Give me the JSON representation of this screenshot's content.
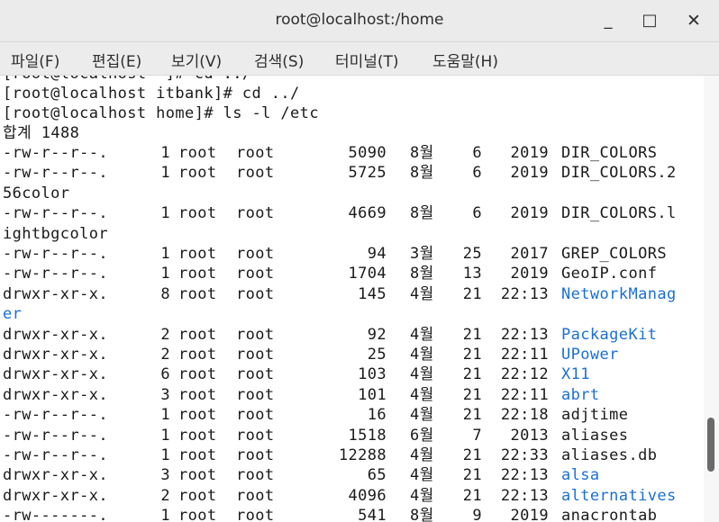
{
  "window": {
    "title": "root@localhost:/home",
    "minimize_label": "_",
    "maximize_label": "□",
    "close_label": "✕"
  },
  "menu": [
    "파일(F)",
    "편집(E)",
    "보기(V)",
    "검색(S)",
    "터미널(T)",
    "도움말(H)"
  ],
  "terminal": {
    "partial_top": "[root@localhost ~]# cd ../",
    "prompt_lines": [
      "[root@localhost itbank]# cd ../",
      "[root@localhost home]# ls -l /etc"
    ],
    "total": "합계 1488",
    "entries": [
      {
        "perm": "-rw-r--r--.",
        "links": "1",
        "owner": "root",
        "group": "root",
        "size": "5090",
        "month": "8월",
        "day": "6",
        "time": "2019",
        "name": "DIR_COLORS",
        "cont": "",
        "dir": false
      },
      {
        "perm": "-rw-r--r--.",
        "links": "1",
        "owner": "root",
        "group": "root",
        "size": "5725",
        "month": "8월",
        "day": "6",
        "time": "2019",
        "name": "DIR_COLORS.2",
        "cont": "56color",
        "dir": false
      },
      {
        "perm": "-rw-r--r--.",
        "links": "1",
        "owner": "root",
        "group": "root",
        "size": "4669",
        "month": "8월",
        "day": "6",
        "time": "2019",
        "name": "DIR_COLORS.l",
        "cont": "ightbgcolor",
        "dir": false
      },
      {
        "perm": "-rw-r--r--.",
        "links": "1",
        "owner": "root",
        "group": "root",
        "size": "94",
        "month": "3월",
        "day": "25",
        "time": "2017",
        "name": "GREP_COLORS",
        "cont": "",
        "dir": false
      },
      {
        "perm": "-rw-r--r--.",
        "links": "1",
        "owner": "root",
        "group": "root",
        "size": "1704",
        "month": "8월",
        "day": "13",
        "time": "2019",
        "name": "GeoIP.conf",
        "cont": "",
        "dir": false
      },
      {
        "perm": "drwxr-xr-x.",
        "links": "8",
        "owner": "root",
        "group": "root",
        "size": "145",
        "month": "4월",
        "day": "21",
        "time": "22:13",
        "name": "NetworkManag",
        "cont": "er",
        "dir": true
      },
      {
        "perm": "drwxr-xr-x.",
        "links": "2",
        "owner": "root",
        "group": "root",
        "size": "92",
        "month": "4월",
        "day": "21",
        "time": "22:13",
        "name": "PackageKit",
        "cont": "",
        "dir": true
      },
      {
        "perm": "drwxr-xr-x.",
        "links": "2",
        "owner": "root",
        "group": "root",
        "size": "25",
        "month": "4월",
        "day": "21",
        "time": "22:11",
        "name": "UPower",
        "cont": "",
        "dir": true
      },
      {
        "perm": "drwxr-xr-x.",
        "links": "6",
        "owner": "root",
        "group": "root",
        "size": "103",
        "month": "4월",
        "day": "21",
        "time": "22:12",
        "name": "X11",
        "cont": "",
        "dir": true
      },
      {
        "perm": "drwxr-xr-x.",
        "links": "3",
        "owner": "root",
        "group": "root",
        "size": "101",
        "month": "4월",
        "day": "21",
        "time": "22:11",
        "name": "abrt",
        "cont": "",
        "dir": true
      },
      {
        "perm": "-rw-r--r--.",
        "links": "1",
        "owner": "root",
        "group": "root",
        "size": "16",
        "month": "4월",
        "day": "21",
        "time": "22:18",
        "name": "adjtime",
        "cont": "",
        "dir": false
      },
      {
        "perm": "-rw-r--r--.",
        "links": "1",
        "owner": "root",
        "group": "root",
        "size": "1518",
        "month": "6월",
        "day": "7",
        "time": "2013",
        "name": "aliases",
        "cont": "",
        "dir": false
      },
      {
        "perm": "-rw-r--r--.",
        "links": "1",
        "owner": "root",
        "group": "root",
        "size": "12288",
        "month": "4월",
        "day": "21",
        "time": "22:33",
        "name": "aliases.db",
        "cont": "",
        "dir": false
      },
      {
        "perm": "drwxr-xr-x.",
        "links": "3",
        "owner": "root",
        "group": "root",
        "size": "65",
        "month": "4월",
        "day": "21",
        "time": "22:13",
        "name": "alsa",
        "cont": "",
        "dir": true
      },
      {
        "perm": "drwxr-xr-x.",
        "links": "2",
        "owner": "root",
        "group": "root",
        "size": "4096",
        "month": "4월",
        "day": "21",
        "time": "22:13",
        "name": "alternatives",
        "cont": "",
        "dir": true
      },
      {
        "perm": "-rw-------.",
        "links": "1",
        "owner": "root",
        "group": "root",
        "size": "541",
        "month": "8월",
        "day": "9",
        "time": "2019",
        "name": "anacrontab",
        "cont": "",
        "dir": false
      }
    ]
  },
  "colors": {
    "directory": "#1a6fd6",
    "text": "#1a1a1a"
  }
}
